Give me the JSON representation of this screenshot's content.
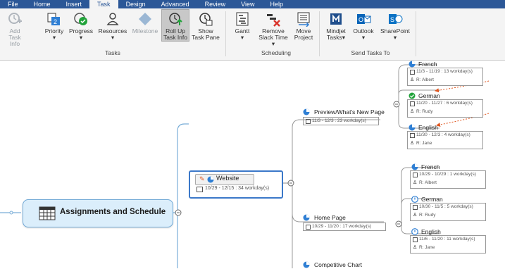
{
  "menu": {
    "items": [
      "File",
      "Home",
      "Insert",
      "Task",
      "Design",
      "Advanced",
      "Review",
      "View",
      "Help"
    ],
    "active": "Task"
  },
  "ribbon": {
    "tasks_group": {
      "label": "Tasks",
      "add_task_info": [
        "Add",
        "Task Info"
      ],
      "priority": "Priority",
      "progress": "Progress",
      "resources": "Resources",
      "milestone": "Milestone",
      "roll_up_task_info": [
        "Roll Up",
        "Task Info"
      ],
      "show_task_pane": [
        "Show",
        "Task Pane"
      ]
    },
    "scheduling_group": {
      "label": "Scheduling",
      "gantt": "Gantt",
      "remove_slack_time": [
        "Remove",
        "Slack Time"
      ],
      "move_project": [
        "Move",
        "Project"
      ]
    },
    "send_group": {
      "label": "Send Tasks To",
      "mindjet_tasks": [
        "Mindjet",
        "Tasks"
      ],
      "outlook": "Outlook",
      "sharepoint": "SharePoint"
    },
    "dropdown_glyph": "▾"
  },
  "map": {
    "central": "Assignments and Schedule",
    "website": {
      "title": "Website",
      "dates": "10/29 - 12/15 : 34 workday(s)"
    },
    "preview": {
      "title": "Preview/What's New Page",
      "dates": "11/3 - 12/3 : 23 workday(s)",
      "french": {
        "title": "French",
        "dates": "11/3 - 11/19 : 13 workday(s)",
        "resource": "R: Albert"
      },
      "german": {
        "title": "German",
        "dates": "11/20 - 11/27 : 6 workday(s)",
        "resource": "R: Rudy"
      },
      "english": {
        "title": "English",
        "dates": "11/30 - 12/3 : 4 workday(s)",
        "resource": "R: Jane"
      }
    },
    "home": {
      "title": "Home Page",
      "dates": "10/29 - 11/20 : 17 workday(s)",
      "french": {
        "title": "French",
        "dates": "10/29 - 10/29 : 1 workday(s)",
        "resource": "R: Albert"
      },
      "german": {
        "title": "German",
        "dates": "10/30 - 11/5 : 5 workday(s)",
        "resource": "R: Rudy"
      },
      "english": {
        "title": "English",
        "dates": "11/6 - 11/20 : 11 workday(s)",
        "resource": "R: Jane"
      }
    },
    "competitive": {
      "title": "Competitive Chart"
    }
  },
  "colors": {
    "menubar": "#2b5797",
    "central_fill": "#dbeefb",
    "central_border": "#6fa8d6",
    "selection": "#3b78c9",
    "progress_blue": "#2f7fd4",
    "done_green": "#22a33b",
    "arrow_orange": "#e0561f"
  }
}
